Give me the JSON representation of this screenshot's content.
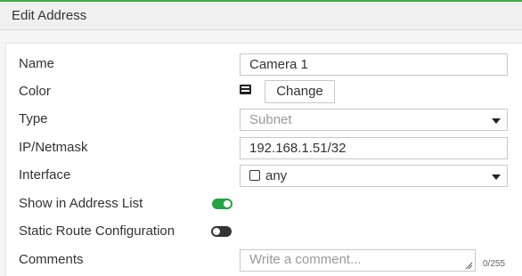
{
  "header": {
    "title": "Edit Address"
  },
  "form": {
    "name": {
      "label": "Name",
      "value": "Camera 1"
    },
    "color": {
      "label": "Color",
      "icon": "color-swatch-icon",
      "button_label": "Change"
    },
    "type": {
      "label": "Type",
      "value": "Subnet",
      "disabled": true
    },
    "ip_netmask": {
      "label": "IP/Netmask",
      "value": "192.168.1.51/32"
    },
    "interface": {
      "label": "Interface",
      "value": "any",
      "icon": "checkbox-icon"
    },
    "show_in_address_list": {
      "label": "Show in Address List",
      "enabled": true
    },
    "static_route_configuration": {
      "label": "Static Route Configuration",
      "enabled": false
    },
    "comments": {
      "label": "Comments",
      "placeholder": "Write a comment...",
      "char_count": "0/255"
    }
  },
  "colors": {
    "accent_green": "#3fae49",
    "toggle_on": "#25a244",
    "toggle_off": "#333333"
  }
}
